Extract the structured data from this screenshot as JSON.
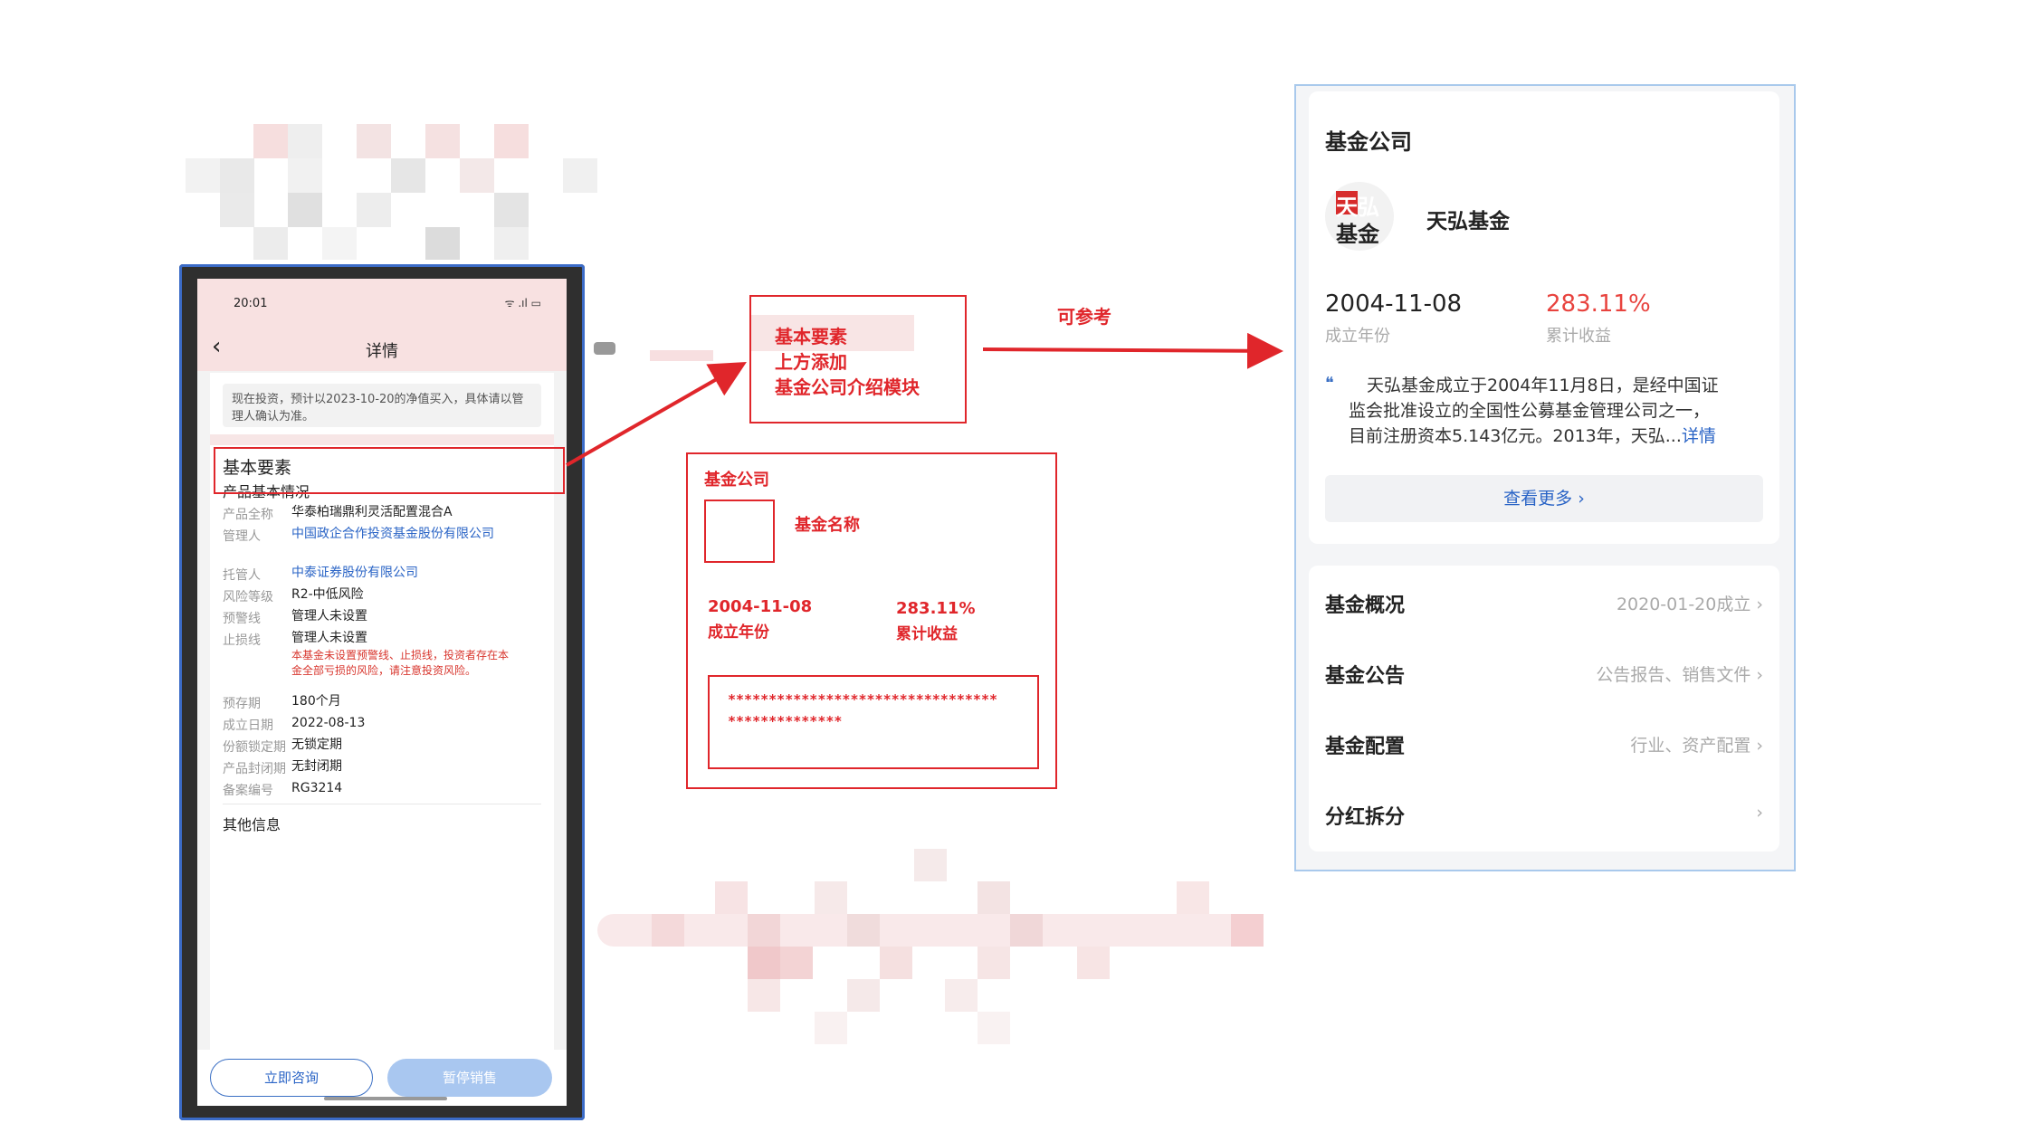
{
  "phone": {
    "time": "20:01",
    "status_icons": "ᯤ .ıl ▭",
    "nav_title": "详情",
    "notice": "现在投资，预计以2023-10-20的净值买入，具体请以管理人确认为准。",
    "section_basic": "基本要素",
    "subsection_product": "产品基本情况",
    "rows": [
      {
        "label": "产品全称",
        "value": "华泰柏瑞鼎利灵活配置混合A"
      },
      {
        "label": "管理人",
        "value": "中国政企合作投资基金股份有限公司"
      },
      {
        "label": "托管人",
        "value": "中泰证券股份有限公司"
      },
      {
        "label": "风险等级",
        "value": "R2-中低风险"
      },
      {
        "label": "预警线",
        "value": "管理人未设置"
      },
      {
        "label": "止损线",
        "value": "管理人未设置"
      },
      {
        "label": "预存期",
        "value": "180个月"
      },
      {
        "label": "成立日期",
        "value": "2022-08-13"
      },
      {
        "label": "份额锁定期",
        "value": "无锁定期"
      },
      {
        "label": "产品封闭期",
        "value": "无封闭期"
      },
      {
        "label": "备案编号",
        "value": "RG3214"
      }
    ],
    "stoploss_warning": "本基金未设置预警线、止损线，投资者存在本金全部亏损的风险，请注意投资风险。",
    "section_other": "其他信息",
    "btn_consult": "立即咨询",
    "btn_pause": "暂停销售"
  },
  "annotation": {
    "note_line1": "基本要素",
    "note_line2": "上方添加",
    "note_line3": "基金公司介绍模块",
    "reference_label": "可参考",
    "wire_title": "基金公司",
    "wire_name": "基金名称",
    "wire_date": "2004-11-08",
    "wire_date_label": "成立年份",
    "wire_return": "283.11%",
    "wire_return_label": "累计收益",
    "wire_desc_line1": "*********************************",
    "wire_desc_line2": "**************"
  },
  "reference": {
    "title": "基金公司",
    "logo_line1": "天弘",
    "logo_line2": "基金",
    "company_name": "天弘基金",
    "date": "2004-11-08",
    "date_label": "成立年份",
    "return": "283.11%",
    "return_label": "累计收益",
    "quote_icon": "❝",
    "desc_line1": "天弘基金成立于2004年11月8日，是经中国证",
    "desc_line2": "监会批准设立的全国性公募基金管理公司之一，",
    "desc_line3": "目前注册资本5.143亿元。2013年，天弘...",
    "desc_link": "详情",
    "see_more": "查看更多 ›",
    "menu": [
      {
        "label": "基金概况",
        "value": "2020-01-20成立 ›"
      },
      {
        "label": "基金公告",
        "value": "公告报告、销售文件 ›"
      },
      {
        "label": "基金配置",
        "value": "行业、资产配置 ›"
      },
      {
        "label": "分红拆分",
        "value": "›"
      }
    ]
  },
  "colors": {
    "annotation_red": "#e0262b",
    "link_blue": "#2a64c6",
    "return_red": "#e8433e"
  }
}
